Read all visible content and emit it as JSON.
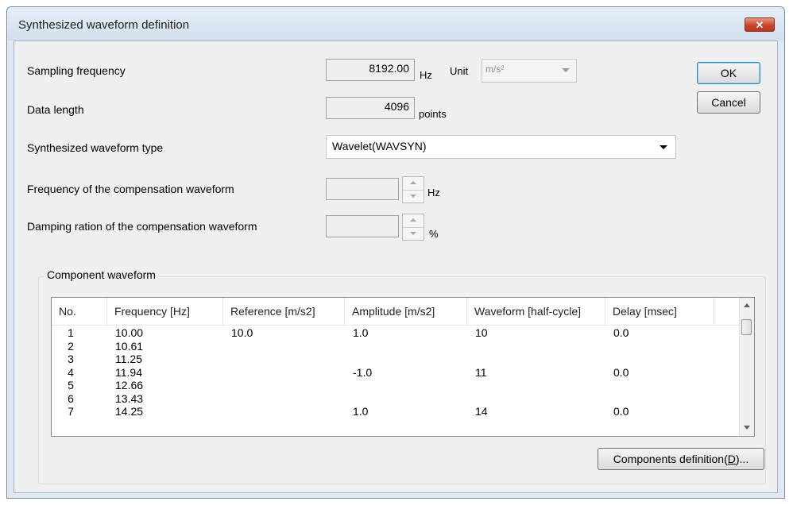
{
  "window": {
    "title": "Synthesized waveform definition",
    "close_glyph": "✕"
  },
  "fields": {
    "sampling_frequency": {
      "label": "Sampling frequency",
      "value": "8192.00",
      "unit": "Hz"
    },
    "unit": {
      "label": "Unit",
      "value": "m/s²"
    },
    "data_length": {
      "label": "Data length",
      "value": "4096",
      "unit": "points"
    },
    "waveform_type": {
      "label": "Synthesized waveform type",
      "value": "Wavelet(WAVSYN)"
    },
    "comp_frequency": {
      "label": "Frequency of the compensation waveform",
      "value": "",
      "unit": "Hz"
    },
    "damping": {
      "label": "Damping ration of the compensation waveform",
      "value": "",
      "unit": "%"
    }
  },
  "buttons": {
    "ok": "OK",
    "cancel": "Cancel",
    "components_prefix": "Components definition(",
    "components_key": "D",
    "components_suffix": ")..."
  },
  "component_group": {
    "title": "Component waveform",
    "columns": [
      "No.",
      "Frequency [Hz]",
      "Reference [m/s2]",
      "Amplitude [m/s2]",
      "Waveform [half-cycle]",
      "Delay [msec]"
    ],
    "rows": [
      {
        "no": "1",
        "freq": "10.00",
        "ref": "10.0",
        "amp": "1.0",
        "wave": "10",
        "delay": "0.0"
      },
      {
        "no": "2",
        "freq": "10.61",
        "ref": "",
        "amp": "",
        "wave": "",
        "delay": ""
      },
      {
        "no": "3",
        "freq": "11.25",
        "ref": "",
        "amp": "",
        "wave": "",
        "delay": ""
      },
      {
        "no": "4",
        "freq": "11.94",
        "ref": "",
        "amp": "-1.0",
        "wave": "11",
        "delay": "0.0"
      },
      {
        "no": "5",
        "freq": "12.66",
        "ref": "",
        "amp": "",
        "wave": "",
        "delay": ""
      },
      {
        "no": "6",
        "freq": "13.43",
        "ref": "",
        "amp": "",
        "wave": "",
        "delay": ""
      },
      {
        "no": "7",
        "freq": "14.25",
        "ref": "",
        "amp": "1.0",
        "wave": "14",
        "delay": "0.0"
      }
    ]
  },
  "colors": {
    "accent_close": "#c7442b",
    "frequency_text": "#800080"
  }
}
